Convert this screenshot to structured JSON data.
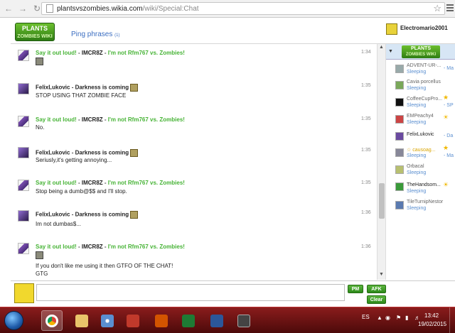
{
  "browser": {
    "url_host": "plantsvszombies.wikia.com",
    "url_path": "/wiki/Special:Chat"
  },
  "header": {
    "logo_line1": "PLANTS",
    "logo_line2": "ZOMBIES WIKI",
    "ping_label": "Ping phrases",
    "ping_count": "(1)",
    "current_user": "Electromario2001"
  },
  "messages": [
    {
      "user": "Say it out loud!",
      "sep": " - ",
      "rank": "IMCR8Z",
      "sep2": " - ",
      "title": "I'm not Rfm767 vs. Zombies!",
      "time": "1:34",
      "text": ""
    },
    {
      "user": "FelixLukovic",
      "sep": " - ",
      "rank": "Darkness is coming",
      "time": "1:35",
      "text": "STOP USING THAT ZOMBIE FACE"
    },
    {
      "user": "Say it out loud!",
      "sep": " - ",
      "rank": "IMCR8Z",
      "sep2": " - ",
      "title": "I'm not Rfm767 vs. Zombies!",
      "time": "1:35",
      "text": "No."
    },
    {
      "user": "FelixLukovic",
      "sep": " - ",
      "rank": "Darkness is coming",
      "time": "1:35",
      "text": "Seriusly,it's getting annoying..."
    },
    {
      "user": "Say it out loud!",
      "sep": " - ",
      "rank": "IMCR8Z",
      "sep2": " - ",
      "title": "I'm not Rfm767 vs. Zombies!",
      "time": "1:35",
      "text": "Stop being a dumb@$$ and I'll stop."
    },
    {
      "user": "FelixLukovic",
      "sep": " - ",
      "rank": "Darkness is coming",
      "time": "1:36",
      "text": "Im not dumbas$..."
    },
    {
      "user": "Say it out loud!",
      "sep": " - ",
      "rank": "IMCR8Z",
      "sep2": " - ",
      "title": "I'm not Rfm767 vs. Zombies!",
      "time": "1:36",
      "text": "If you don't like me using it then GTFO OF THE CHAT!",
      "text2": "GTG"
    }
  ],
  "userlist": {
    "logo_line1": "PLANTS",
    "logo_line2": "ZOMBIES WIKI",
    "users": [
      {
        "name": "ADVENT-UR-...",
        "status": "Sleeping",
        "extra": "- Ma"
      },
      {
        "name": "Cavia porcellus",
        "status": "Sleeping",
        "extra": ""
      },
      {
        "name": "CoffeeCupPro...",
        "status": "Sleeping",
        "extra": "- SP"
      },
      {
        "name": "EMPeachy4",
        "status": "Sleeping",
        "extra": ""
      },
      {
        "name": "FelixLukovic",
        "status": "",
        "extra": "- Da"
      },
      {
        "name": "☆ causoag...",
        "status": "Sleeping",
        "extra": "- Ma"
      },
      {
        "name": "Orbacal",
        "status": "Sleeping",
        "extra": ""
      },
      {
        "name": "TheHandsom...",
        "status": "Sleeping",
        "extra": ""
      },
      {
        "name": "TileTurnipNestor",
        "status": "Sleeping",
        "extra": ""
      }
    ]
  },
  "input": {
    "pm_label": "PM",
    "afk_label": "AFK",
    "clear_label": "Clear"
  },
  "taskbar": {
    "lang": "ES",
    "time": "13:42",
    "date": "19/02/2015"
  },
  "colors": {
    "green_name": "#46b335",
    "taskbar": "#6b1212",
    "status_blue": "#5b8fd0"
  }
}
